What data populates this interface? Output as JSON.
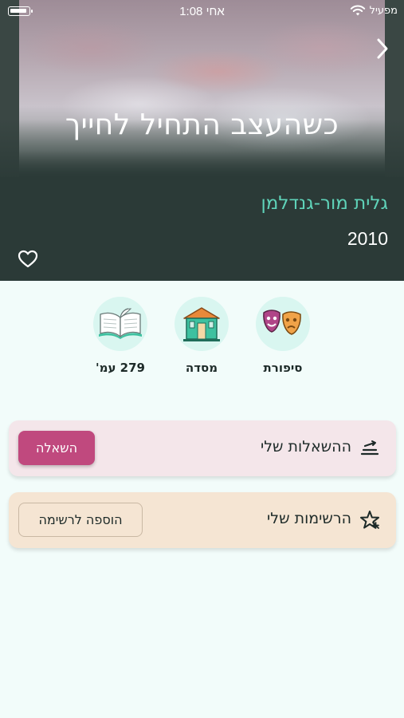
{
  "status_bar": {
    "carrier": "מפעיל",
    "time": "1:08 אחי"
  },
  "book": {
    "title": "כשהעצב התחיל לחייך",
    "author": "גלית מור-גנדלמן",
    "year": "2010"
  },
  "info": {
    "genre": "סיפורת",
    "publisher": "מסדה",
    "pages": "279 עמ'"
  },
  "loans": {
    "label": "ההשאלות שלי",
    "button": "השאלה"
  },
  "lists": {
    "label": "הרשימות שלי",
    "button": "הוספה לרשימה"
  },
  "colors": {
    "hero_bg": "#2b3a37",
    "author": "#5fd3b9",
    "page_bg": "#f2fcfa",
    "loan_button": "#c0497e",
    "loans_card": "#f4e6ea",
    "lists_card": "#f5e5d3"
  },
  "icons": {
    "genre": "theater-masks-icon",
    "publisher": "building-icon",
    "pages": "open-book-icon",
    "loans": "loans-icon",
    "lists": "star-list-icon",
    "favorite": "heart-icon",
    "back": "chevron-right-icon"
  }
}
